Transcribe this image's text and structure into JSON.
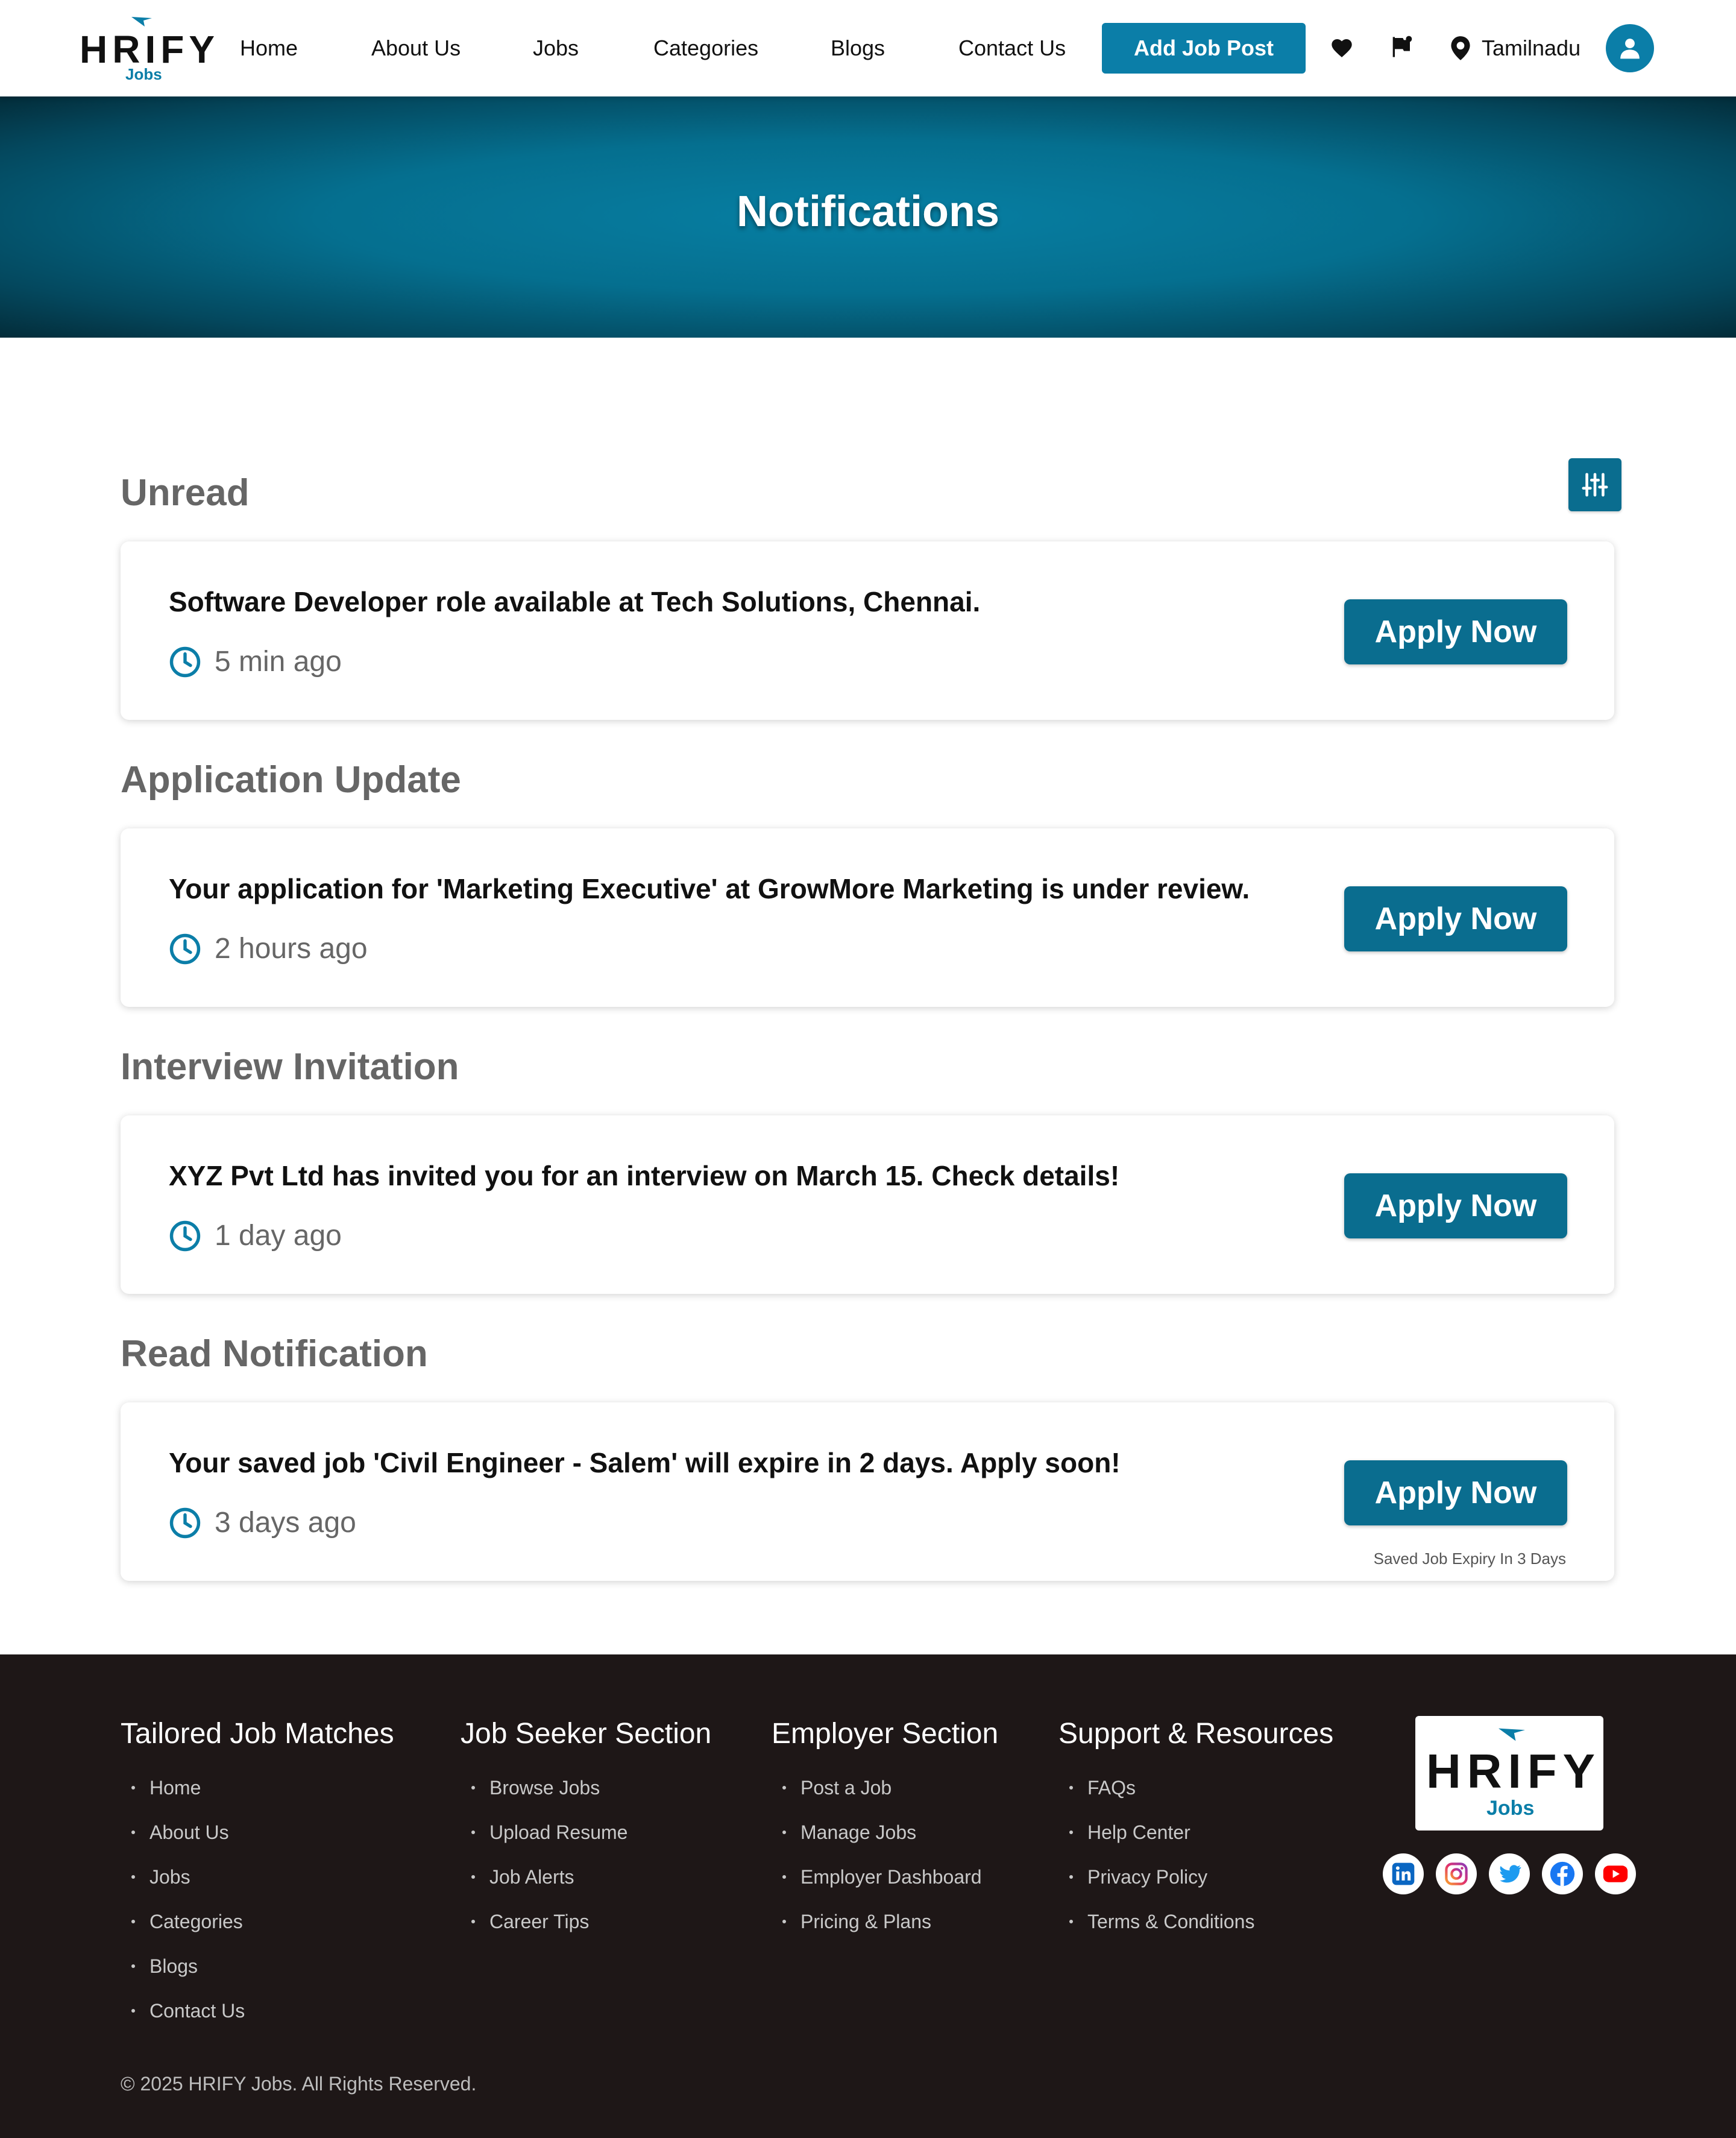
{
  "header": {
    "logo_text": "HRIFY",
    "logo_sub": "Jobs",
    "nav": [
      "Home",
      "About Us",
      "Jobs",
      "Categories",
      "Blogs",
      "Contact Us"
    ],
    "add_job_label": "Add Job Post",
    "location": "Tamilnadu",
    "icons": [
      "heart-icon",
      "flag-icon",
      "location-pin-icon",
      "user-icon"
    ]
  },
  "banner": {
    "title": "Notifications"
  },
  "notifications": [
    {
      "section": "Unread",
      "message": "Software Developer role available at Tech Solutions, Chennai.",
      "time": "5 min ago",
      "action": "Apply Now"
    },
    {
      "section": "Application Update",
      "message": "Your application for 'Marketing Executive' at GrowMore Marketing is under review.",
      "time": "2 hours ago",
      "action": "Apply Now"
    },
    {
      "section": "Interview Invitation",
      "message": "XYZ Pvt Ltd has invited you for an interview on March 15. Check details!",
      "time": "1 day ago",
      "action": "Apply Now"
    },
    {
      "section": "Read Notification",
      "message": "Your saved job 'Civil Engineer - Salem' will expire in 2 days. Apply soon!",
      "time": "3 days ago",
      "action": "Apply Now",
      "note": "Saved Job Expiry In 3 Days"
    }
  ],
  "footer": {
    "columns": [
      {
        "title": "Tailored Job Matches",
        "items": [
          "Home",
          "About Us",
          "Jobs",
          "Categories",
          "Blogs",
          "Contact Us"
        ]
      },
      {
        "title": "Job Seeker Section",
        "items": [
          "Browse Jobs",
          "Upload Resume",
          "Job Alerts",
          "Career Tips"
        ]
      },
      {
        "title": "Employer Section",
        "items": [
          "Post a Job",
          "Manage Jobs",
          "Employer Dashboard",
          "Pricing & Plans"
        ]
      },
      {
        "title": "Support & Resources",
        "items": [
          "FAQs",
          "Help Center",
          "Privacy Policy",
          "Terms & Conditions"
        ]
      }
    ],
    "logo_text": "HRIFY",
    "logo_sub": "Jobs",
    "social": [
      "linkedin-icon",
      "instagram-icon",
      "twitter-icon",
      "facebook-icon",
      "youtube-icon"
    ],
    "copyright": "© 2025 HRIFY Jobs. All Rights Reserved."
  },
  "colors": {
    "brand": "#0b7ea8",
    "button": "#0a6d8f",
    "footer_bg": "#1e1717"
  }
}
